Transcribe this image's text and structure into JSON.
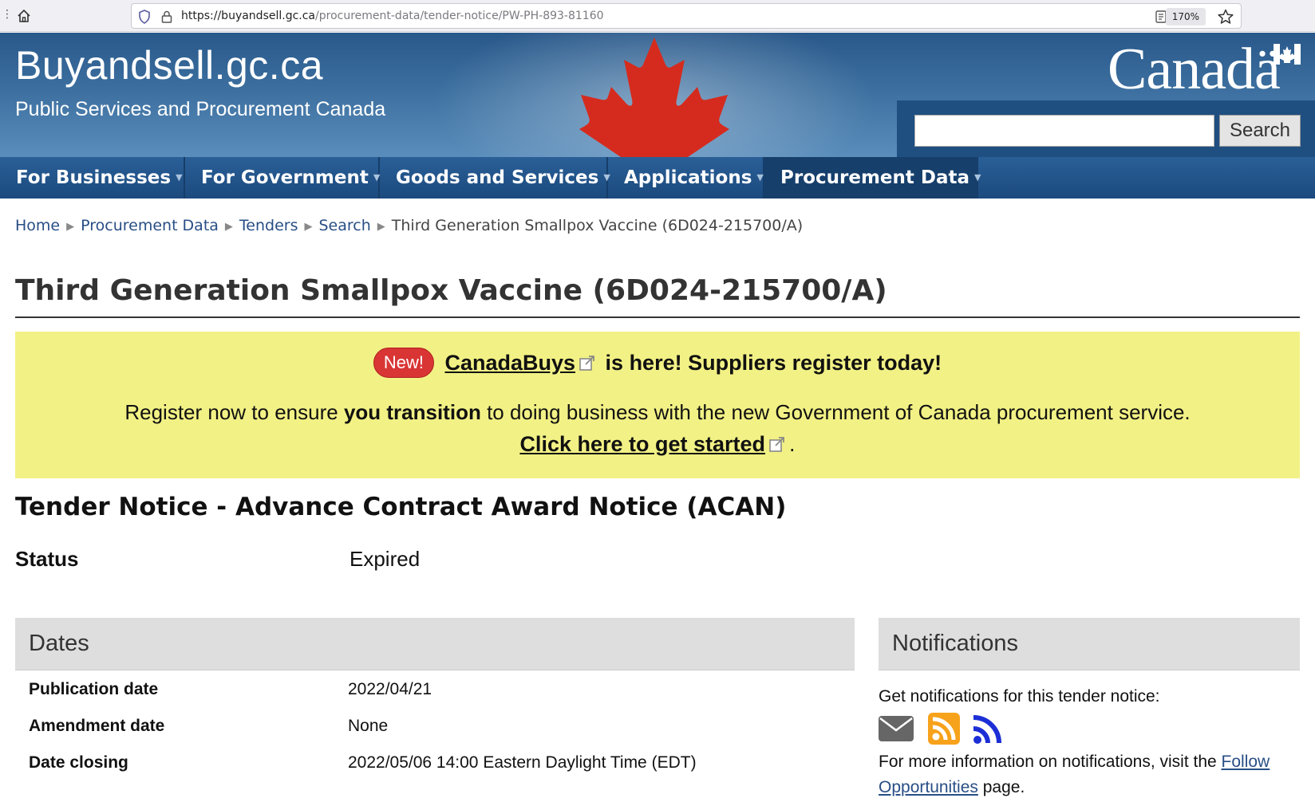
{
  "browser": {
    "url_host": "https://buyandsell.gc.ca",
    "url_path": "/procurement-data/tender-notice/PW-PH-893-81160",
    "zoom": "170%"
  },
  "header": {
    "site_title": "Buyandsell.gc.ca",
    "subtitle": "Public Services and Procurement Canada",
    "wordmark": "Canadä",
    "search_value": "",
    "search_button": "Search"
  },
  "nav": {
    "items": [
      {
        "label": "For Businesses"
      },
      {
        "label": "For Government"
      },
      {
        "label": "Goods and Services"
      },
      {
        "label": "Applications"
      },
      {
        "label": "Procurement Data"
      }
    ],
    "active": "Procurement Data"
  },
  "breadcrumb": {
    "items": [
      "Home",
      "Procurement Data",
      "Tenders",
      "Search"
    ],
    "current": "Third Generation Smallpox Vaccine (6D024-215700/A)"
  },
  "page": {
    "title": "Third Generation Smallpox Vaccine (6D024-215700/A)"
  },
  "notice": {
    "badge": "New!",
    "link_text": "CanadaBuys",
    "line1_rest": "is here! Suppliers register today!",
    "line2_a": "Register now to ensure ",
    "line2_bold": "you transition",
    "line2_b": " to doing business with the new Government of Canada procurement service.",
    "cta": "Click here to get started",
    "cta_after": "."
  },
  "tender": {
    "heading": "Tender Notice - Advance Contract Award Notice (ACAN)",
    "status_label": "Status",
    "status_value": "Expired"
  },
  "dates": {
    "heading": "Dates",
    "rows": [
      {
        "label": "Publication date",
        "value": "2022/04/21"
      },
      {
        "label": "Amendment date",
        "value": "None"
      },
      {
        "label": "Date closing",
        "value": "2022/05/06 14:00 Eastern Daylight Time (EDT)"
      }
    ]
  },
  "notifications": {
    "heading": "Notifications",
    "intro": "Get notifications for this tender notice:",
    "more_a": "For more information on notifications, visit the ",
    "link_part1": "Follow",
    "link_part2": "Opportunities",
    "more_b": " page.",
    "icons": [
      "email-icon",
      "rss-icon",
      "feed-icon"
    ]
  },
  "colors": {
    "banner": "#29588a",
    "nav": "#1b4a7e",
    "notice_bg": "#f2f185",
    "badge": "#d93535",
    "link": "#284e86"
  }
}
